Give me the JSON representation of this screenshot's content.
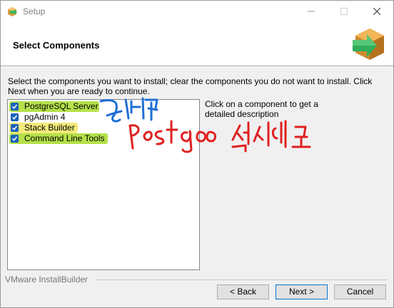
{
  "window": {
    "title": "Setup"
  },
  "header": {
    "title": "Select Components"
  },
  "instructions": "Select the components you want to install; clear the components you do not want to install. Click Next when you are ready to continue.",
  "components": [
    {
      "label": "PostgreSQL Server",
      "checked": true,
      "highlight": "#b5e04a"
    },
    {
      "label": "pgAdmin 4",
      "checked": true,
      "highlight": null
    },
    {
      "label": "Stack Builder",
      "checked": true,
      "highlight": "#f4ea7a"
    },
    {
      "label": "Command Line Tools",
      "checked": true,
      "highlight": "#b5e04a"
    }
  ],
  "description": "Click on a component to get a detailed description",
  "footer": {
    "brand": "VMware InstallBuilder"
  },
  "buttons": {
    "back": "< Back",
    "next": "Next >",
    "cancel": "Cancel"
  },
  "colors": {
    "checkbox": "#1c62b9",
    "annotation_blue": "#1f6fd6",
    "annotation_red": "#e02020",
    "highlight_green": "#b5e04a",
    "highlight_yellow": "#f4ea7a"
  },
  "annotations": {
    "blue_note": "필수",
    "red_note": "postgres 설치에 필요"
  }
}
